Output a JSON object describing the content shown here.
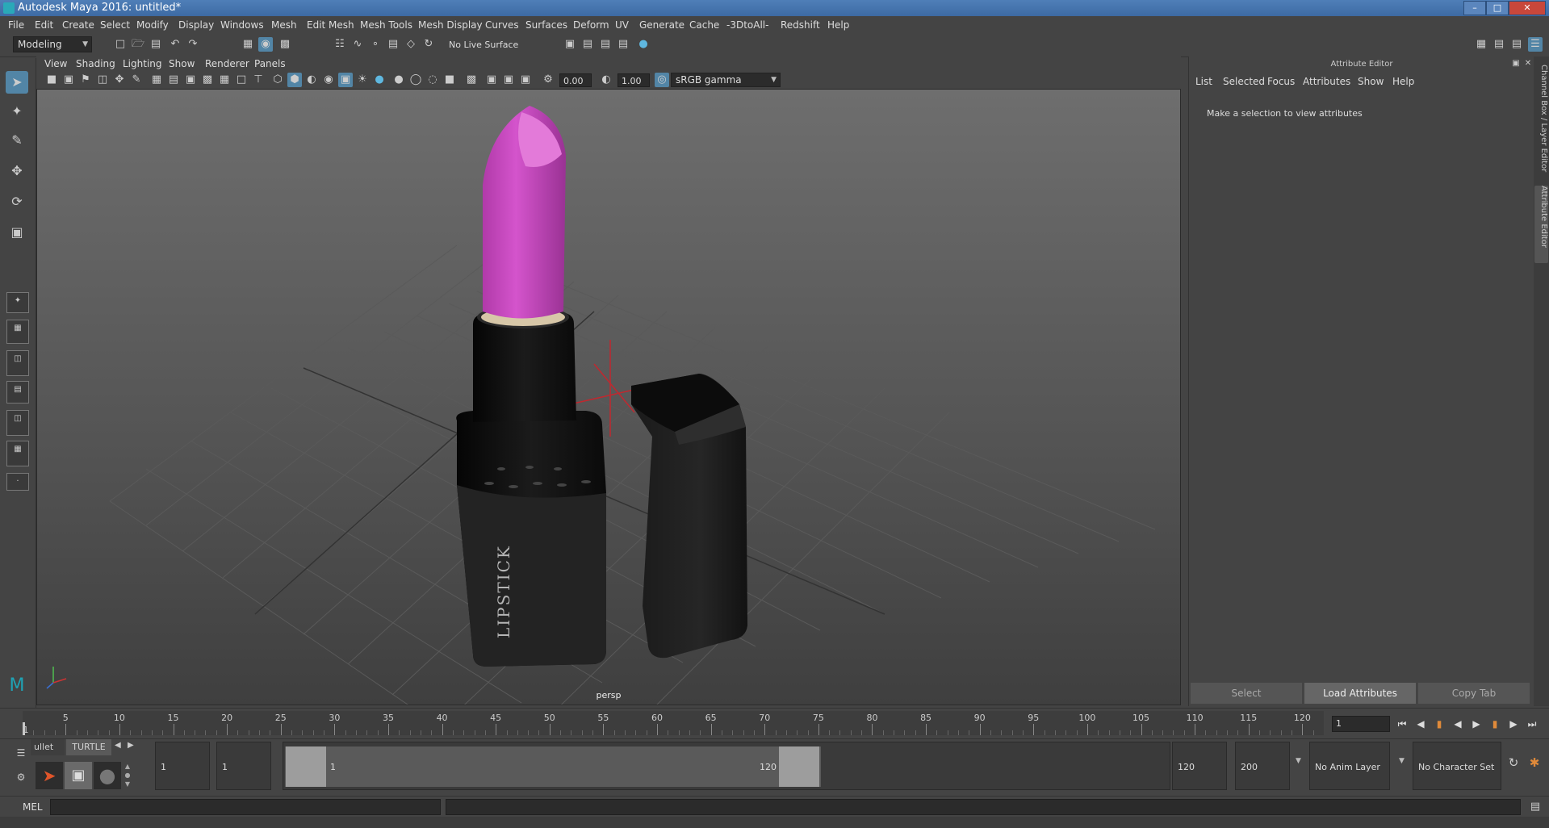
{
  "window": {
    "title": "Autodesk Maya 2016: untitled*"
  },
  "menus": [
    "File",
    "Edit",
    "Create",
    "Select",
    "Modify",
    "Display",
    "Windows",
    "Mesh",
    "Edit Mesh",
    "Mesh Tools",
    "Mesh Display",
    "Curves",
    "Surfaces",
    "Deform",
    "UV",
    "Generate",
    "Cache",
    "-3DtoAll-",
    "Redshift",
    "Help"
  ],
  "toolbar": {
    "mode": "Modeling",
    "live_surface": "No Live Surface"
  },
  "viewport": {
    "menus": [
      "View",
      "Shading",
      "Lighting",
      "Show",
      "Renderer",
      "Panels"
    ],
    "exposure": "0.00",
    "gamma": "1.00",
    "color_space": "sRGB gamma",
    "camera": "persp",
    "model_label": "LIPSTICK",
    "lipstick_color": "#cc44c4"
  },
  "attribute_editor": {
    "title": "Attribute Editor",
    "menus": [
      "List",
      "Selected",
      "Focus",
      "Attributes",
      "Show",
      "Help"
    ],
    "message": "Make a selection to view attributes",
    "buttons": {
      "select": "Select",
      "load": "Load Attributes",
      "copy": "Copy Tab"
    }
  },
  "side_tabs": {
    "channel_box": "Channel Box / Layer Editor",
    "attribute_editor": "Attribute Editor"
  },
  "timeline": {
    "labels": [
      "1",
      "5",
      "10",
      "15",
      "20",
      "25",
      "30",
      "35",
      "40",
      "45",
      "50",
      "55",
      "60",
      "65",
      "70",
      "75",
      "80",
      "85",
      "90",
      "95",
      "100",
      "105",
      "110",
      "115",
      "120"
    ],
    "current_frame": "1"
  },
  "range": {
    "shelf_tabs": [
      "ullet",
      "TURTLE"
    ],
    "start_frame": "1",
    "playback_start": "1",
    "range_start_label": "1",
    "range_end_label": "120",
    "playback_end": "120",
    "end_frame": "200",
    "anim_layer": "No Anim Layer",
    "character_set": "No Character Set"
  },
  "command_line": {
    "label": "MEL"
  },
  "colors": {
    "accent": "#5285a6",
    "title_bar": "#4f7fb8"
  }
}
